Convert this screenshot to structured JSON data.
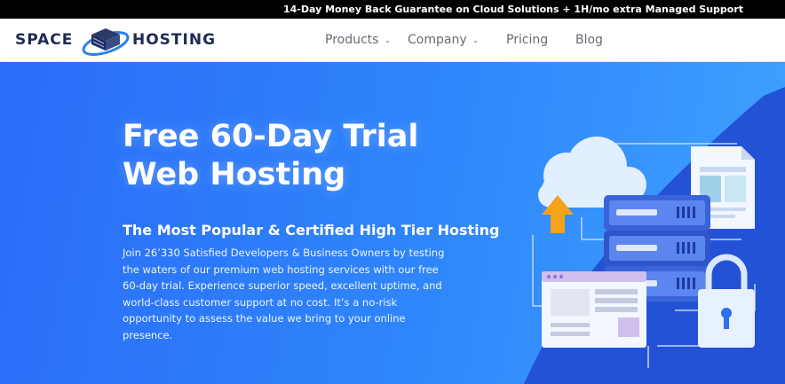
{
  "announcement": "14-Day Money Back Guarantee on Cloud Solutions + 1H/mo extra Managed Support",
  "brand": {
    "word1": "SPACE",
    "word2": "HOSTING"
  },
  "nav": {
    "items": [
      {
        "label": "Products",
        "has_dropdown": true
      },
      {
        "label": "Company",
        "has_dropdown": true
      },
      {
        "label": "Pricing",
        "has_dropdown": false
      },
      {
        "label": "Blog",
        "has_dropdown": false
      }
    ]
  },
  "hero": {
    "title_line1": "Free 60-Day Trial",
    "title_line2": "Web Hosting",
    "subtitle": "The Most Popular & Certified High Tier Hosting",
    "body": "Join 26’330 Satisfied Developers & Business Owners by testing the waters of our premium web hosting services with our free 60-day trial. Experience superior speed, excellent uptime, and world-class customer support at no cost. It’s a no-risk opportunity to assess the value we bring to your online presence."
  },
  "icons": {
    "dropdown": "chevron-down-icon",
    "illustration": "cloud-server-illustration"
  },
  "colors": {
    "topbar_bg": "#000000",
    "hero_start": "#2a6cf7",
    "hero_end": "#3fa2ff",
    "brand_navy": "#1e2a55",
    "nav_text": "#666a73"
  }
}
